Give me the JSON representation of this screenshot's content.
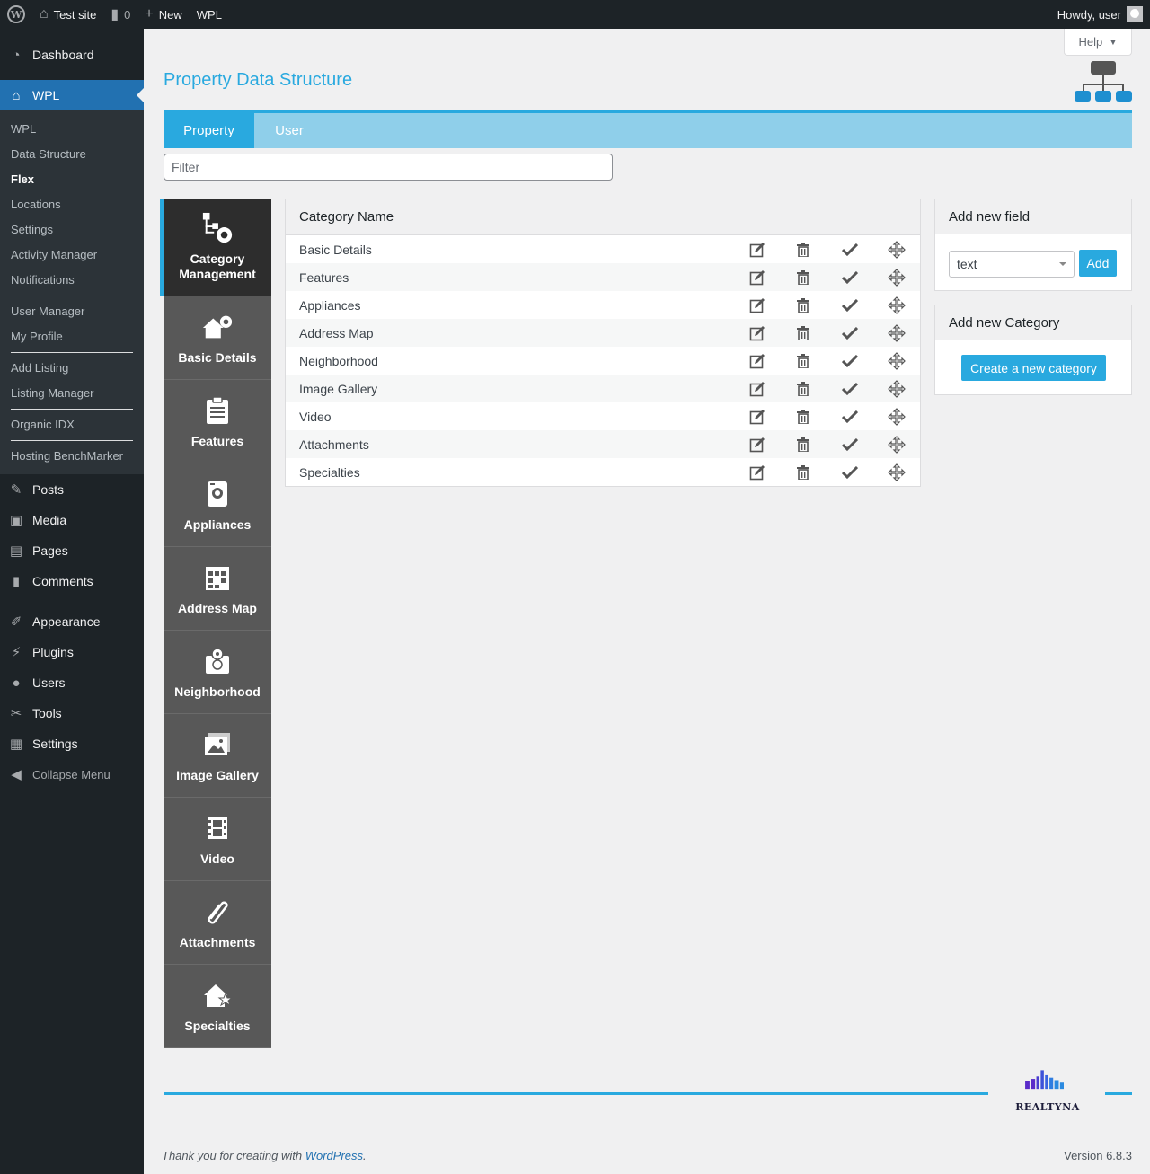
{
  "adminbar": {
    "site_name": "Test site",
    "comments_count": "0",
    "new_label": "New",
    "wpl_label": "WPL",
    "greeting": "Howdy, user"
  },
  "sidebar": {
    "dashboard": "Dashboard",
    "wpl": "WPL",
    "submenu": [
      "WPL",
      "Data Structure",
      "Flex",
      "Locations",
      "Settings",
      "Activity Manager",
      "Notifications",
      "User Manager",
      "My Profile",
      "Add Listing",
      "Listing Manager",
      "Organic IDX",
      "Hosting BenchMarker"
    ],
    "current_sub": "Flex",
    "items": [
      "Posts",
      "Media",
      "Pages",
      "Comments",
      "Appearance",
      "Plugins",
      "Users",
      "Tools",
      "Settings"
    ],
    "collapse": "Collapse Menu"
  },
  "page": {
    "help": "Help",
    "title": "Property Data Structure",
    "tabs": [
      "Property",
      "User"
    ],
    "filter_placeholder": "Filter"
  },
  "categories_nav": [
    "Category Management",
    "Basic Details",
    "Features",
    "Appliances",
    "Address Map",
    "Neighborhood",
    "Image Gallery",
    "Video",
    "Attachments",
    "Specialties"
  ],
  "table": {
    "header": "Category Name",
    "rows": [
      "Basic Details",
      "Features",
      "Appliances",
      "Address Map",
      "Neighborhood",
      "Image Gallery",
      "Video",
      "Attachments",
      "Specialties"
    ]
  },
  "add_field": {
    "title": "Add new field",
    "select_value": "text",
    "button": "Add"
  },
  "add_category": {
    "title": "Add new Category",
    "button": "Create a new category"
  },
  "footer": {
    "brand": "REALTYNA",
    "thanks_prefix": "Thank you for creating with ",
    "thanks_link": "WordPress",
    "thanks_suffix": ".",
    "version": "Version 6.8.3"
  },
  "colors": {
    "accent": "#29a9df",
    "tab_bar": "#8fcfea",
    "wp_blue": "#2271b1",
    "admin_dark": "#1d2327"
  }
}
